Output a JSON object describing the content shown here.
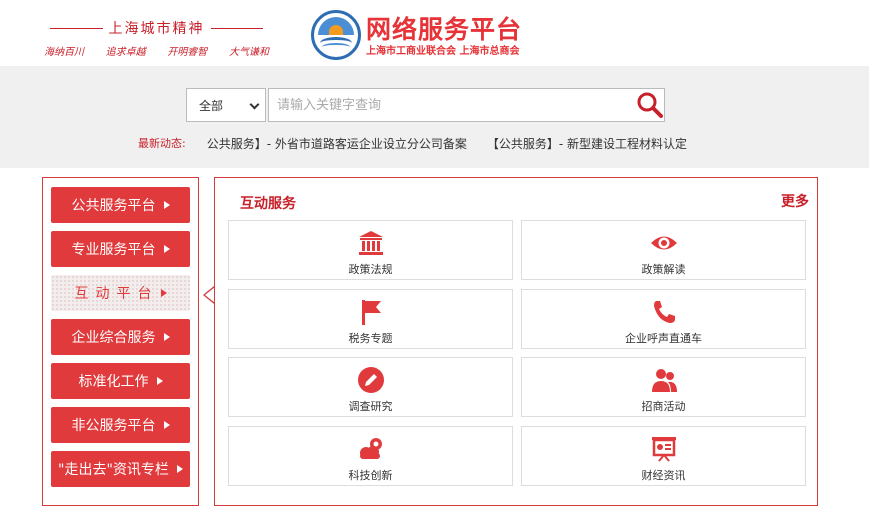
{
  "header": {
    "slogan_title": "上海城市精神",
    "slogan_parts": [
      "海纳百川",
      "追求卓越",
      "开明睿智",
      "大气谦和"
    ],
    "brand_title": "网络服务平台",
    "brand_sub": "上海市工商业联合会 上海市总商会"
  },
  "search": {
    "scope_selected": "全部",
    "placeholder": "请输入关键字查询"
  },
  "news": {
    "label": "最新动态:",
    "items": [
      "公共服务】- 外省市道路客运企业设立分公司备案",
      "【公共服务】- 新型建设工程材料认定"
    ]
  },
  "nav": {
    "items": [
      "公共服务平台",
      "专业服务平台",
      "互动平台",
      "企业综合服务",
      "标准化工作",
      "非公服务平台",
      "\"走出去\"资讯专栏"
    ]
  },
  "panel": {
    "title": "互动服务",
    "more": "更多",
    "cards": [
      {
        "label": "政策法规",
        "icon": "government-building-icon"
      },
      {
        "label": "政策解读",
        "icon": "eye-icon"
      },
      {
        "label": "税务专题",
        "icon": "flag-icon"
      },
      {
        "label": "企业呼声直通车",
        "icon": "phone-icon"
      },
      {
        "label": "调查研究",
        "icon": "pencil-icon"
      },
      {
        "label": "招商活动",
        "icon": "users-icon"
      },
      {
        "label": "科技创新",
        "icon": "cloud-gear-icon"
      },
      {
        "label": "财经资讯",
        "icon": "presentation-icon"
      }
    ]
  },
  "colors": {
    "accent": "#e03a3c",
    "dark_red": "#c8202a",
    "brand_blue": "#2e6db4"
  }
}
